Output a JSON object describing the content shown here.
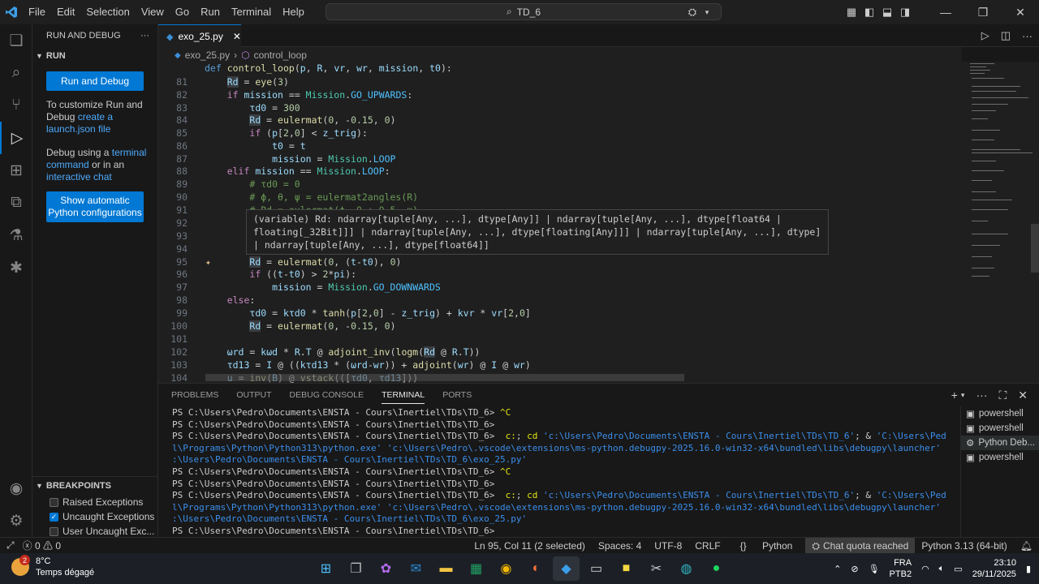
{
  "titlebar": {
    "menu": [
      "File",
      "Edit",
      "Selection",
      "View",
      "Go",
      "Run",
      "Terminal",
      "Help"
    ],
    "search_text": "TD_6"
  },
  "sidebar": {
    "title": "RUN AND DEBUG",
    "section": "RUN",
    "run_button": "Run and Debug",
    "customize_text": "To customize Run and Debug",
    "customize_link": "create a launch.json file",
    "debug_text_1": "Debug using a",
    "debug_link_1": "terminal command",
    "debug_text_2": "or in an",
    "debug_link_2": "interactive chat",
    "python_button": "Show automatic Python configurations",
    "breakpoints": {
      "title": "BREAKPOINTS",
      "items": [
        {
          "label": "Raised Exceptions",
          "checked": false
        },
        {
          "label": "Uncaught Exceptions",
          "checked": true
        },
        {
          "label": "User Uncaught Exc...",
          "checked": false
        }
      ]
    }
  },
  "editor": {
    "tab_name": "exo_25.py",
    "breadcrumb_file": "exo_25.py",
    "breadcrumb_symbol": "control_loop",
    "hover_text": "(variable) Rd: ndarray[tuple[Any, ...], dtype[Any]] | ndarray[tuple[Any, ...], dtype[float64 | floating[_32Bit]]] | ndarray[tuple[Any, ...], dtype[floating[Any]]] | ndarray[tuple[Any, ...], dtype] | ndarray[tuple[Any, ...], dtype[float64]]"
  },
  "panel": {
    "tabs": [
      "PROBLEMS",
      "OUTPUT",
      "DEBUG CONSOLE",
      "TERMINAL",
      "PORTS"
    ],
    "active_tab": "TERMINAL",
    "terminals": [
      "powershell",
      "powershell",
      "Python Deb...",
      "powershell"
    ]
  },
  "statusbar": {
    "errors": "0",
    "warnings": "0",
    "position": "Ln 95, Col 11 (2 selected)",
    "spaces": "Spaces: 4",
    "encoding": "UTF-8",
    "eol": "CRLF",
    "language": "Python",
    "quota": "Chat quota reached",
    "interpreter": "Python 3.13 (64-bit)"
  },
  "taskbar": {
    "temperature": "8°C",
    "weather": "Temps dégagé",
    "weather_badge": "2",
    "lang": "FRA",
    "layout": "PTB2",
    "time": "23:10",
    "date": "29/11/2025"
  }
}
